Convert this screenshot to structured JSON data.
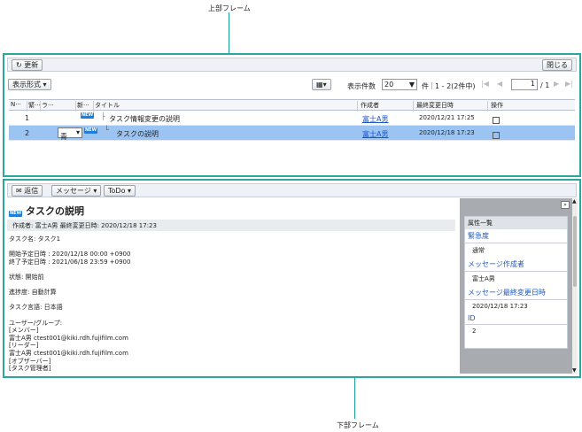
{
  "labels": {
    "top": "上部フレーム",
    "bottom": "下部フレーム"
  },
  "top": {
    "refresh": "更新",
    "close": "閉じる",
    "display_format": "表示形式",
    "count_label": "表示件数",
    "count_value": "20",
    "count_unit": "件",
    "count_info": "1 - 2(2件中)",
    "page_value": "1",
    "page_total": "/ 1",
    "columns": [
      "N···",
      "緊···",
      "ラ···",
      "新···",
      "タイトル",
      "作成者",
      "最終変更日時",
      "操作"
    ],
    "rows": [
      {
        "num": "1",
        "label": "",
        "new": "NEW",
        "title": "タスク情報変更の説明",
        "author": "富士A男",
        "date": "2020/12/21 17:25"
      },
      {
        "num": "2",
        "label": "青",
        "new": "NEW",
        "title": "タスクの説明",
        "author": "富士A男",
        "date": "2020/12/18 17:23"
      }
    ]
  },
  "bottom": {
    "reply": "返信",
    "message": "メッセージ",
    "todo": "ToDo",
    "title": "タスクの説明",
    "meta": "作成者: 富士A男 最終変更日時: 2020/12/18 17:23",
    "lines": [
      "タスク名: タスク1",
      "",
      "開始予定日時 : 2020/12/18 00:00 +0900",
      "終了予定日時 : 2021/06/18 23:59 +0900",
      "",
      "状態: 開始前",
      "",
      "進捗度: 自動計算",
      "",
      "タスク言語: 日本語",
      "",
      "ユーザー/グループ:",
      "[メンバー]",
      "富士A男 ctest001@kiki.rdh.fujifilm.com",
      "[リーダー]",
      "富士A男 ctest001@kiki.rdh.fujifilm.com",
      "[オブザーバー]",
      "[タスク管理者]"
    ],
    "props_title": "属性一覧",
    "props": [
      {
        "label": "緊急度",
        "value": "通常"
      },
      {
        "label": "メッセージ作成者",
        "value": "富士A男"
      },
      {
        "label": "メッセージ最終変更日時",
        "value": "2020/12/18 17:23"
      },
      {
        "label": "ID",
        "value": "2"
      }
    ]
  }
}
